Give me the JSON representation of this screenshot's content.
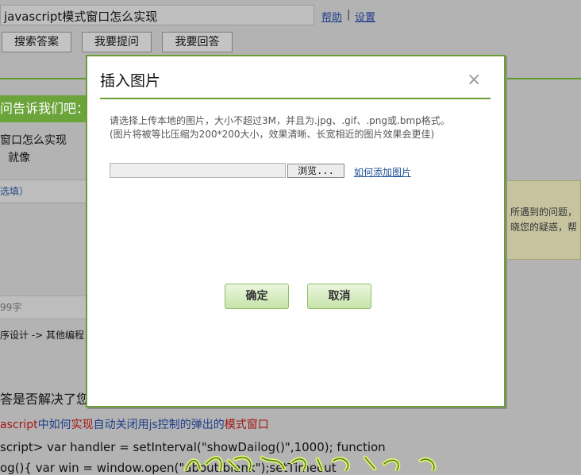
{
  "background": {
    "search": {
      "value": "javascript模式窗口怎么实现"
    },
    "links": {
      "help": "帮助",
      "separator": "|",
      "settings": "设置"
    },
    "buttons": {
      "search_answers": "搜索答案",
      "ask": "我要提问",
      "answer": "我要回答"
    },
    "banner_text": "问告诉我们吧：",
    "question_line1": "窗口怎么实现",
    "question_line2": "就像",
    "optional_label": "选填）",
    "right_notice_line1": "所遇到的问题，",
    "right_notice_line2": "晓您的疑惑，帮",
    "char_count": "99字",
    "category": "序设计 -> 其他编程",
    "resolved_question": "答是否解决了您",
    "related_title": {
      "part1": "ascript",
      "part2": "中如何",
      "part3": "实现",
      "part4": "自动关闭用js控制的弹出的",
      "part5": "模式窗口"
    },
    "code_line1": "script> var handler = setInterval(\"showDailog()\",1000); function",
    "code_line2": "og(){ var win = window.open(\"about:blank\");setTimeout"
  },
  "modal": {
    "title": "插入图片",
    "close": "×",
    "hint_line1": "请选择上传本地的图片，大小不超过3M，并且为.jpg、.gif、.png或.bmp格式。",
    "hint_line2": "(图片将被等比压缩为200*200大小，效果清晰、长宽相近的图片效果会更佳)",
    "browse": "浏览...",
    "help_link": "如何添加图片",
    "confirm": "确定",
    "cancel": "取消"
  }
}
